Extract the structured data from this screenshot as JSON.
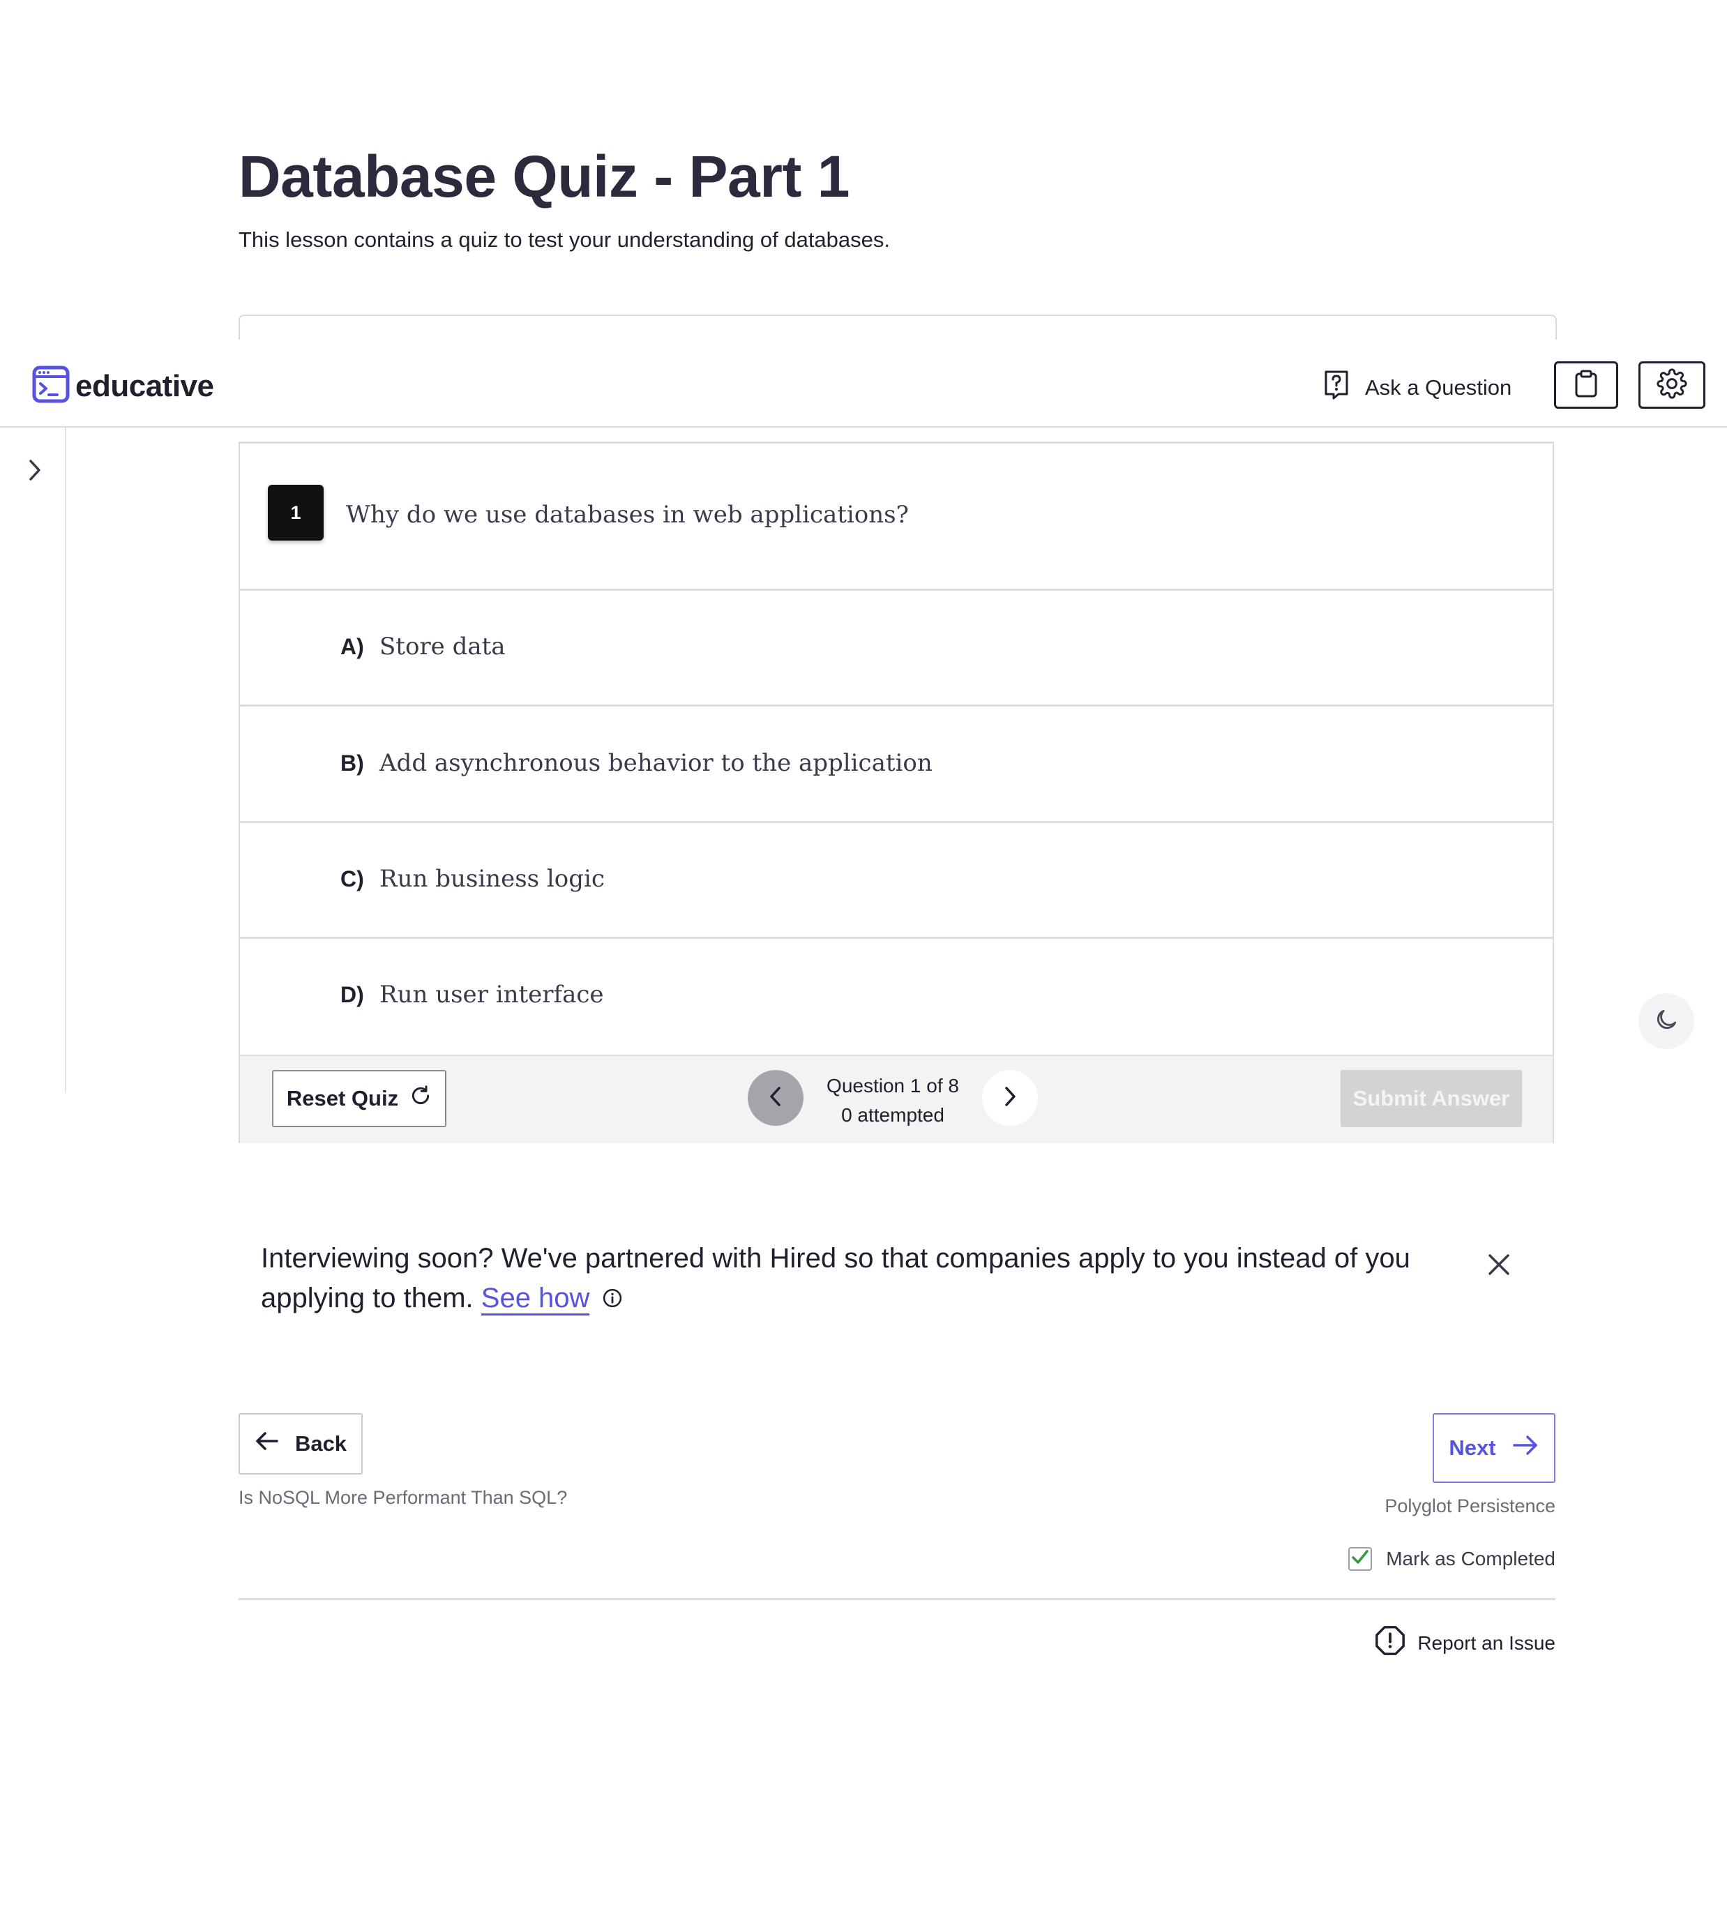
{
  "lesson": {
    "title": "Database Quiz - Part 1",
    "subtitle": "This lesson contains a quiz to test your understanding of databases."
  },
  "navbar": {
    "logo_text": "educative",
    "ask_question_label": "Ask a Question",
    "icons": [
      "question-box-icon",
      "clipboard-icon",
      "gear-icon"
    ]
  },
  "quiz": {
    "question_number": "1",
    "question_text": "Why do we use databases in web applications?",
    "options": [
      {
        "letter": "A)",
        "text": "Store data"
      },
      {
        "letter": "B)",
        "text": "Add asynchronous behavior to the application"
      },
      {
        "letter": "C)",
        "text": "Run business logic"
      },
      {
        "letter": "D)",
        "text": "Run user interface"
      }
    ],
    "reset_label": "Reset Quiz",
    "progress_label": "Question 1 of 8",
    "attempted_label": "0 attempted",
    "submit_label": "Submit Answer"
  },
  "promo": {
    "text": "Interviewing soon? We've partnered with Hired so that companies apply to you instead of you applying to them.",
    "link_label": "See how"
  },
  "lesson_nav": {
    "back_label": "Back",
    "back_lesson": "Is NoSQL More Performant Than SQL?",
    "next_label": "Next",
    "next_lesson": "Polyglot Persistence",
    "mark_completed_label": "Mark as Completed",
    "report_label": "Report an Issue"
  },
  "colors": {
    "accent": "#5553e0",
    "text": "#1f1f2e",
    "badge_bg": "#111111",
    "submit_disabled": "#d3d3d6",
    "check_green": "#2e9d3a"
  }
}
